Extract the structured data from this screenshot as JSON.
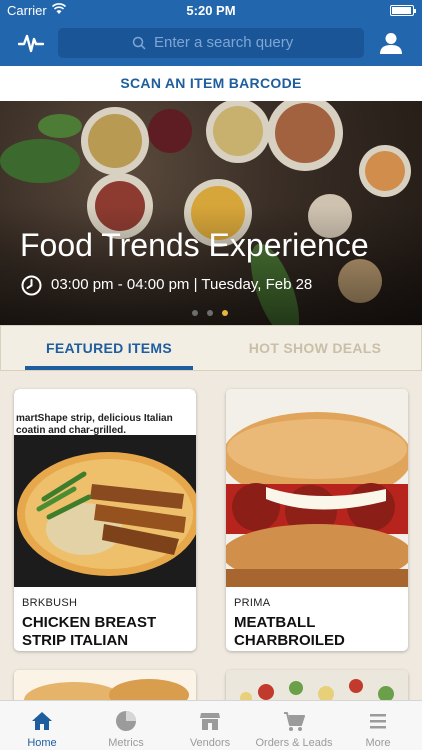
{
  "status": {
    "carrier": "Carrier",
    "time": "5:20 PM"
  },
  "nav": {
    "search_placeholder": "Enter a search query",
    "pulse_icon": "activity-pulse-icon",
    "profile_icon": "user-icon"
  },
  "scan": {
    "label": "SCAN AN ITEM BARCODE"
  },
  "hero": {
    "title": "Food Trends Experience",
    "time_text": "03:00 pm - 04:00 pm | Tuesday, Feb 28",
    "dots": 3,
    "active_dot": 3
  },
  "tabs": [
    {
      "label": "FEATURED ITEMS",
      "active": true
    },
    {
      "label": "HOT SHOW DEALS",
      "active": false
    }
  ],
  "cards": [
    {
      "brand": "BRKBUSH",
      "name": "CHICKEN BREAST STRIP ITALIAN",
      "image_caption": "martShape strip, delicious Italian coatin and char-grilled."
    },
    {
      "brand": "PRIMA",
      "name": "MEATBALL CHARBROILED"
    }
  ],
  "tab_bar": [
    {
      "label": "Home",
      "icon": "home-icon",
      "active": true
    },
    {
      "label": "Metrics",
      "icon": "pie-chart-icon",
      "active": false
    },
    {
      "label": "Vendors",
      "icon": "storefront-icon",
      "active": false
    },
    {
      "label": "Orders & Leads",
      "icon": "cart-icon",
      "active": false
    },
    {
      "label": "More",
      "icon": "menu-icon",
      "active": false
    }
  ],
  "colors": {
    "brand_blue": "#2266ad",
    "accent_dark_blue": "#1e5d9e",
    "dot_active": "#e3b63e"
  }
}
